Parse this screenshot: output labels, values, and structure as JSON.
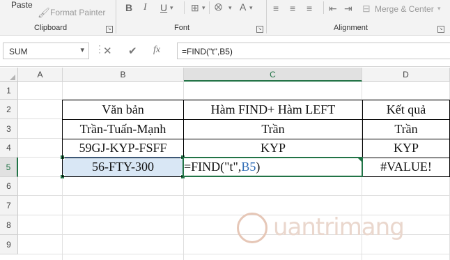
{
  "ribbon": {
    "clipboard": {
      "paste_label": "Paste",
      "format_painter_label": "Format Painter",
      "group_label": "Clipboard"
    },
    "font": {
      "group_label": "Font",
      "bold": "B",
      "italic": "I",
      "underline": "U",
      "font_color": "A"
    },
    "alignment": {
      "merge_center_label": "Merge & Center",
      "group_label": "Alignment"
    }
  },
  "formula_bar": {
    "name_box": "SUM",
    "cancel_icon": "close-icon",
    "enter_icon": "checkmark-icon",
    "fx_label": "fx",
    "formula": "=FIND(\"t\",B5)"
  },
  "grid": {
    "columns": [
      "A",
      "B",
      "C",
      "D"
    ],
    "rows": [
      "1",
      "2",
      "3",
      "4",
      "5",
      "6",
      "7",
      "8",
      "9"
    ],
    "cells": {
      "B2": "Văn bản",
      "C2": "Hàm FIND+ Hàm LEFT",
      "D2": "Kết quả",
      "B3": "Trần-Tuấn-Mạnh",
      "C3": "Trần",
      "D3": "Trần",
      "B4": "59GJ-KYP-FSFF",
      "C4": "KYP",
      "D4": "KYP",
      "B5": "56-FTY-300",
      "C5_prefix": "=FIND(\"t\",",
      "C5_ref": "B5",
      "C5_suffix": ")",
      "D5": "#VALUE!"
    }
  },
  "colors": {
    "accent": "#217346",
    "reference": "#2e6bb5",
    "selection": "#d9e7f5"
  }
}
